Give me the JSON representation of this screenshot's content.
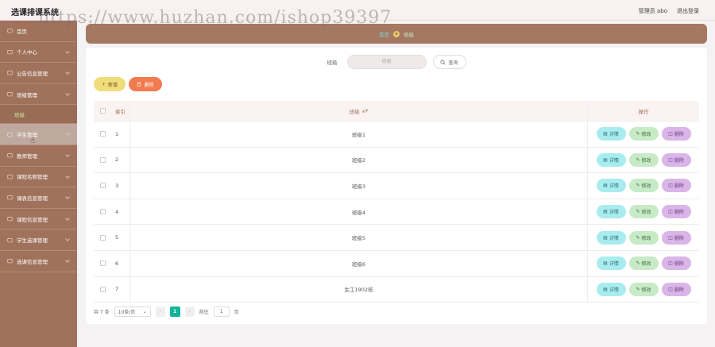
{
  "header": {
    "app_title": "选课排课系统",
    "user_label": "管理员 abo",
    "logout_label": "退出登录"
  },
  "watermark": "https://www.huzhan.com/ishop39397",
  "sidebar": {
    "items": [
      {
        "label": "首页",
        "icon": "home-icon",
        "has_submenu": false,
        "active": false
      },
      {
        "label": "个人中心",
        "icon": "user-icon",
        "has_submenu": true,
        "active": false
      },
      {
        "label": "公告信息管理",
        "icon": "notice-icon",
        "has_submenu": true,
        "active": false
      },
      {
        "label": "班级管理",
        "icon": "class-icon",
        "has_submenu": true,
        "active": false,
        "submenu": [
          "班级"
        ]
      },
      {
        "label": "学生管理",
        "icon": "chart-icon",
        "has_submenu": true,
        "active": true
      },
      {
        "label": "教师管理",
        "icon": "teacher-icon",
        "has_submenu": true,
        "active": false
      },
      {
        "label": "课程名称管理",
        "icon": "book-icon",
        "has_submenu": true,
        "active": false
      },
      {
        "label": "课表信息管理",
        "icon": "schedule-icon",
        "has_submenu": true,
        "active": false
      },
      {
        "label": "课程信息管理",
        "icon": "course-icon",
        "has_submenu": true,
        "active": false
      },
      {
        "label": "学生选课管理",
        "icon": "select-icon",
        "has_submenu": true,
        "active": false
      },
      {
        "label": "选课信息管理",
        "icon": "info-icon",
        "has_submenu": true,
        "active": false
      }
    ]
  },
  "breadcrumb": {
    "home": "首页",
    "current": "班级"
  },
  "search": {
    "label": "班级",
    "placeholder": "班级",
    "button_label": "查询"
  },
  "actions": {
    "add_label": "新增",
    "delete_label": "删除"
  },
  "table": {
    "headers": {
      "index": "索引",
      "name": "班级",
      "ops": "操作"
    },
    "op_labels": {
      "detail": "详情",
      "edit": "修改",
      "remove": "删除"
    },
    "rows": [
      {
        "index": "1",
        "name": "班级1"
      },
      {
        "index": "2",
        "name": "班级2"
      },
      {
        "index": "3",
        "name": "班级3"
      },
      {
        "index": "4",
        "name": "班级4"
      },
      {
        "index": "5",
        "name": "班级5"
      },
      {
        "index": "6",
        "name": "班级6"
      },
      {
        "index": "7",
        "name": "生工1902班"
      }
    ]
  },
  "pagination": {
    "total_label": "共 7 条",
    "page_size": "10条/页",
    "current_page": "1",
    "goto_label": "前往",
    "goto_value": "1",
    "page_suffix": "页"
  },
  "colors": {
    "sidebar": "#a0725b",
    "breadcrumb": "#a57861",
    "add": "#f0dc7b",
    "delete": "#f27a4f",
    "detail": "#a9ecef",
    "edit": "#c8eac7",
    "remove": "#d9b5e8",
    "active_page": "#12b39a"
  }
}
